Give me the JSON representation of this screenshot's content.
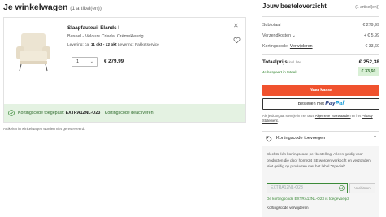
{
  "cart": {
    "title": "Je winkelwagen",
    "item_count": "(1 artikel(en))",
    "item": {
      "name": "Slaapfauteuil Elands I",
      "subtitle": "Buxeel - Velours Criada: Crèmekleurig",
      "delivery_prefix": "Levering: ca.",
      "delivery_dates": "11 okt - 12 okt",
      "delivery_suffix": "Levering: Pakketservice",
      "quantity": "1",
      "price": "€ 279,99"
    },
    "coupon_applied_label": "Kortingscode toegepast:",
    "coupon_code": "EXTRA12NL-O23",
    "coupon_deactivate": "Kortingscode deactiveren",
    "note": "Artikelen in winkelwagen worden niet gereserveerd."
  },
  "overview": {
    "title": "Jouw besteloverzicht",
    "item_count": "(1 artikel(en))",
    "subtotal_label": "Subtotaal",
    "subtotal_value": "€ 279,99",
    "shipping_label": "Verzendkosten",
    "shipping_value": "+ € 5,99",
    "discount_label": "Kortingscode:",
    "discount_remove": "Verwijderen",
    "discount_value": "– € 33,60",
    "total_label": "Totaalprijs",
    "total_incl": "incl. btw",
    "total_value": "€ 252,38",
    "saved_label": "Je bespaart in totaal:",
    "saved_value": "€ 33,60",
    "checkout_button": "Naar kassa",
    "paypal_prefix": "Bestellen met",
    "paypal_brand_1": "Pay",
    "paypal_brand_2": "Pal",
    "legal_1": "Als je doorgaat stem je in met onze",
    "legal_link_1": "Algemene Voorwaarden",
    "legal_2": "en het",
    "legal_link_2": "Privacy Statement",
    "legal_3": "."
  },
  "coupon_panel": {
    "title": "Kortingscode toevoegen",
    "info": "Slechts één kortingscode per bestelling. Alleen geldig voor producten die door home24 SE worden verkocht en verzonden. Niet geldig op producten met het label \"Special\".",
    "input_value": "EXTRA12NL-O23",
    "verify_button": "Verifiëren",
    "applied_message": "De kortingscode EXTRA12NL-O23 is toegevoegd.",
    "remove_link": "Kortingscode verwijderen"
  },
  "colors": {
    "accent_orange": "#f0522e",
    "success_green": "#3b8a38",
    "success_bg": "#e4f2e2",
    "paypal_dark": "#253b80",
    "paypal_light": "#179bd7"
  },
  "icons": [
    "close-icon",
    "heart-icon",
    "chevron-down-icon",
    "check-circle-icon",
    "tag-icon",
    "chevron-up-icon"
  ]
}
